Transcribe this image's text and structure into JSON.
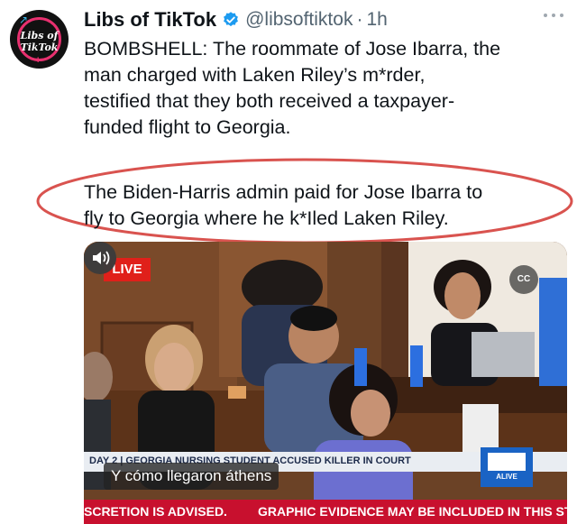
{
  "tweet": {
    "author_name": "Libs of TikTok",
    "handle": "@libsoftiktok",
    "separator": "·",
    "time": "1h",
    "avatar_line1": "Libs of",
    "avatar_line2": "TikTok",
    "text_lines": [
      "BOMBSHELL: The roommate of Jose Ibarra, the",
      "man charged with Laken Riley’s m*rder,",
      "testified that they both received a taxpayer-",
      "funded flight to Georgia."
    ],
    "quote_lines": [
      "The Biden-Harris admin paid for Jose Ibarra to",
      "fly to Georgia where he k*Iled Laken Riley."
    ]
  },
  "video": {
    "live_label": "LIVE",
    "cc_label": "CC",
    "lower_third": "DAY 2 | GEORGIA NURSING STUDENT ACCUSED KILLER IN COURT",
    "station_label": "ALIVE",
    "subtitle": "Y cómo llegaron áthens",
    "ticker_left": "SCRETION IS ADVISED.",
    "ticker_right": "GRAPHIC EVIDENCE MAY BE INCLUDED IN THIS STREA"
  },
  "colors": {
    "verified": "#1d9bf0",
    "oval": "#d9534f",
    "live": "#e0201a",
    "ticker": "#c8102e",
    "badge": "#1a63c4"
  },
  "icons": [
    "verified-badge-icon",
    "more-options-icon",
    "closed-captions-icon",
    "sound-icon"
  ]
}
